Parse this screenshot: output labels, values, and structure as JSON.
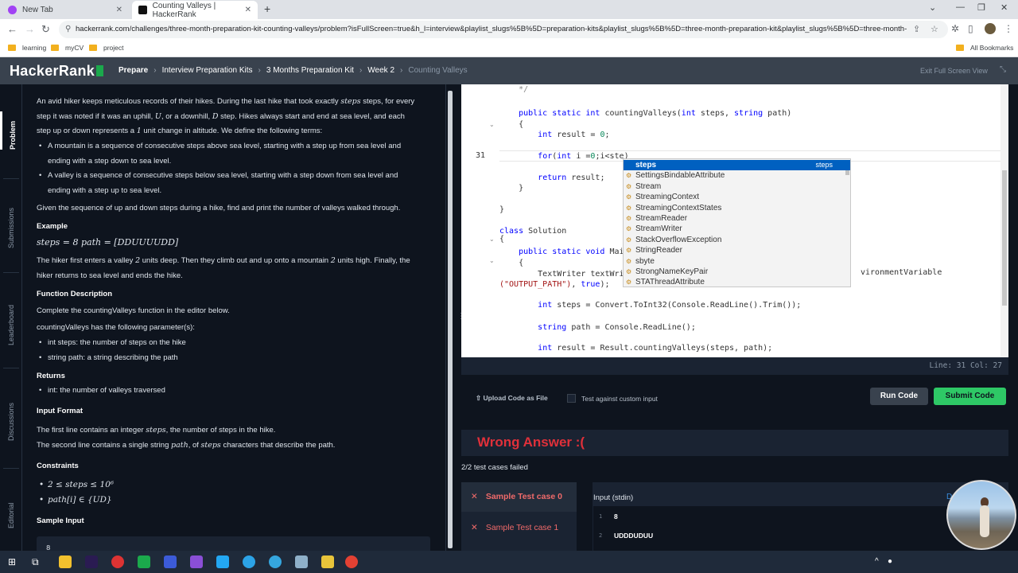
{
  "browser": {
    "tabs": [
      {
        "title": "New Tab",
        "favicon_color": "#a142f4",
        "active": false
      },
      {
        "title": "Counting Valleys | HackerRank",
        "favicon_color": "#111111",
        "active": true
      }
    ],
    "url": "hackerrank.com/challenges/three-month-preparation-kit-counting-valleys/problem?isFullScreen=true&h_l=interview&playlist_slugs%5B%5D=preparation-kits&playlist_slugs%5B%5D=three-month-preparation-kit&playlist_slugs%5B%5D=three-month-...",
    "bookmarks": [
      "learning",
      "myCV",
      "project"
    ],
    "all_bookmarks": "All Bookmarks"
  },
  "header": {
    "logo": "HackerRank",
    "breadcrumbs": [
      "Prepare",
      "Interview Preparation Kits",
      "3 Months Preparation Kit",
      "Week 2",
      "Counting Valleys"
    ],
    "exit_fullscreen": "Exit Full Screen View"
  },
  "side_tabs": [
    "Problem",
    "Submissions",
    "Leaderboard",
    "Discussions",
    "Editorial"
  ],
  "problem": {
    "intro_a": "An avid hiker keeps meticulous records of their hikes. During the last hike that took exactly",
    "intro_var_steps": "steps",
    "intro_b": "steps, for every",
    "intro_line2_a": "step it was noted if it was an uphill,",
    "intro_U": "U",
    "intro_line2_b": ", or a downhill,",
    "intro_D": "D",
    "intro_line2_c": "step. Hikes always start and end at sea level, and each",
    "intro_line3_a": "step up or down represents a",
    "intro_one": "1",
    "intro_line3_b": "unit change in altitude. We define the following terms:",
    "terms": [
      [
        "A mountain is a sequence of consecutive steps above sea level, starting with a step up from sea level and",
        "ending with a step down to sea level."
      ],
      [
        "A valley is a sequence of consecutive steps below sea level, starting with a step down from sea level and",
        "ending with a step up to sea level."
      ]
    ],
    "given": "Given the sequence of up and down steps during a hike, find and print the number of valleys walked through.",
    "example_heading": "Example",
    "example_math": "steps = 8 path = [DDUUUUDD]",
    "example_desc_1a": "The hiker first enters a valley",
    "example_two_a": "2",
    "example_desc_1b": "units deep. Then they climb out and up onto a mountain",
    "example_two_b": "2",
    "example_desc_1c": "units high. Finally, the",
    "example_desc_2": "hiker returns to sea level and ends the hike.",
    "function_heading": "Function Description",
    "function_desc": "Complete the countingValleys function in the editor below.",
    "params_intro": "countingValleys has the following parameter(s):",
    "params": [
      "int steps: the number of steps on the hike",
      "string path: a string describing the path"
    ],
    "returns_heading": "Returns",
    "returns": [
      "int: the number of valleys traversed"
    ],
    "input_heading": "Input Format",
    "input_line1_a": "The first line contains an integer",
    "input_line1_var": "steps",
    "input_line1_b": ", the number of steps in the hike.",
    "input_line2_a": "The second line contains a single string",
    "input_line2_var": "path",
    "input_line2_b": ", of",
    "input_line2_var2": "steps",
    "input_line2_c": "characters that describe the path.",
    "constraints_heading": "Constraints",
    "constraints": [
      "2 ≤ steps ≤ 10⁶",
      "path[i] ∈ {UD}"
    ],
    "sample_heading": "Sample Input",
    "sample_first": "8"
  },
  "editor": {
    "current_line_number": "31",
    "lines": [
      {
        "parts": [
          [
            "cm",
            "    */"
          ]
        ]
      },
      {
        "parts": [
          [
            "",
            ""
          ]
        ]
      },
      {
        "parts": [
          [
            "kw",
            "    public static "
          ],
          [
            "kw",
            "int"
          ],
          [
            "",
            " countingValleys("
          ],
          [
            "kw",
            "int"
          ],
          [
            "",
            " steps, "
          ],
          [
            "kw",
            "string"
          ],
          [
            "",
            " path)"
          ]
        ]
      },
      {
        "parts": [
          [
            "",
            "    {"
          ]
        ]
      },
      {
        "parts": [
          [
            "",
            "        "
          ],
          [
            "kw",
            "int"
          ],
          [
            "",
            " result = "
          ],
          [
            "num",
            "0"
          ],
          [
            "",
            ";"
          ]
        ]
      },
      {
        "parts": [
          [
            "",
            ""
          ]
        ]
      },
      {
        "parts": [
          [
            "",
            "        "
          ],
          [
            "kw",
            "for"
          ],
          [
            "",
            "("
          ],
          [
            "kw",
            "int"
          ],
          [
            "",
            " i ="
          ],
          [
            "num",
            "0"
          ],
          [
            "",
            ";i<ste)"
          ]
        ]
      },
      {
        "parts": [
          [
            "",
            ""
          ]
        ]
      },
      {
        "parts": [
          [
            "",
            "        "
          ],
          [
            "kw",
            "return"
          ],
          [
            "",
            " result;"
          ]
        ]
      },
      {
        "parts": [
          [
            "",
            "    }"
          ]
        ]
      },
      {
        "parts": [
          [
            "",
            ""
          ]
        ]
      },
      {
        "parts": [
          [
            "",
            "}"
          ]
        ]
      },
      {
        "parts": [
          [
            "",
            ""
          ]
        ]
      },
      {
        "parts": [
          [
            "kw",
            "class"
          ],
          [
            "",
            " Solution"
          ]
        ]
      },
      {
        "parts": [
          [
            "",
            "{"
          ]
        ]
      },
      {
        "parts": [
          [
            "kw",
            "    public static void"
          ],
          [
            "",
            " Mai"
          ]
        ]
      },
      {
        "parts": [
          [
            "",
            "    {"
          ]
        ]
      },
      {
        "parts": [
          [
            "",
            "        TextWriter textWri"
          ]
        ]
      },
      {
        "parts": [
          [
            "str",
            "(\"OUTPUT_PATH\")"
          ],
          [
            "",
            ", "
          ],
          [
            "kw",
            "true"
          ],
          [
            "",
            ");"
          ]
        ]
      },
      {
        "parts": [
          [
            "",
            ""
          ]
        ]
      },
      {
        "parts": [
          [
            "",
            "        "
          ],
          [
            "kw",
            "int"
          ],
          [
            "",
            " steps = Convert.ToInt32(Console.ReadLine().Trim());"
          ]
        ]
      },
      {
        "parts": [
          [
            "",
            ""
          ]
        ]
      },
      {
        "parts": [
          [
            "",
            "        "
          ],
          [
            "kw",
            "string"
          ],
          [
            "",
            " path = Console.ReadLine();"
          ]
        ]
      },
      {
        "parts": [
          [
            "",
            ""
          ]
        ]
      },
      {
        "parts": [
          [
            "",
            "        "
          ],
          [
            "kw",
            "int"
          ],
          [
            "",
            " result = Result.countingValleys(steps, path);"
          ]
        ]
      }
    ],
    "env_var_fragment": "vironmentVariable",
    "autocomplete": [
      {
        "label": "steps",
        "detail": "steps",
        "selected": true
      },
      {
        "label": "SettingsBindableAttribute"
      },
      {
        "label": "Stream"
      },
      {
        "label": "StreamingContext"
      },
      {
        "label": "StreamingContextStates"
      },
      {
        "label": "StreamReader"
      },
      {
        "label": "StreamWriter"
      },
      {
        "label": "StackOverflowException"
      },
      {
        "label": "StringReader"
      },
      {
        "label": "sbyte"
      },
      {
        "label": "StrongNameKeyPair"
      },
      {
        "label": "STAThreadAttribute"
      }
    ],
    "status": "Line: 31 Col: 27"
  },
  "actions": {
    "upload": "Upload Code as File",
    "custom_input": "Test against custom input",
    "run": "Run Code",
    "submit": "Submit Code"
  },
  "result": {
    "verdict": "Wrong Answer :(",
    "summary": "2/2 test cases failed",
    "testcases": [
      "Sample Test case 0",
      "Sample Test case 1"
    ],
    "input_label": "Input (stdin)",
    "download": "Download",
    "input_lines": [
      {
        "n": "1",
        "v": "8"
      },
      {
        "n": "2",
        "v": "UDDDUDUU"
      }
    ]
  },
  "colors": {
    "accent_green": "#2ec866",
    "error_red": "#e0303a",
    "header_bg": "#39424e",
    "page_bg": "#0e141e"
  }
}
